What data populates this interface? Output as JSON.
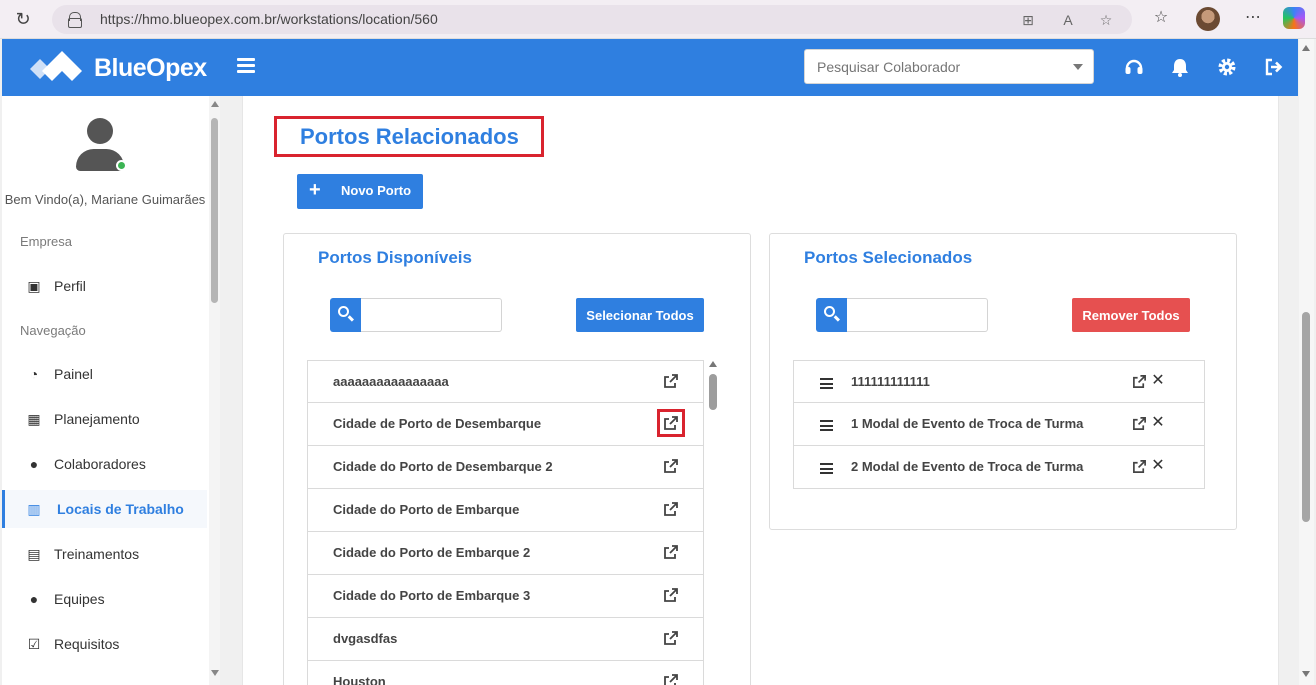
{
  "browser": {
    "url": "https://hmo.blueopex.com.br/workstations/location/560"
  },
  "header": {
    "brand": "BlueOpex",
    "search_placeholder": "Pesquisar Colaborador"
  },
  "sidebar": {
    "welcome": "Bem Vindo(a), Mariane Guimarães",
    "section_empresa": "Empresa",
    "section_navegacao": "Navegação",
    "items": [
      {
        "label": "Perfil",
        "icon": "briefcase-icon"
      },
      {
        "label": "Painel",
        "icon": "dashboard-icon"
      },
      {
        "label": "Planejamento",
        "icon": "calendar-icon"
      },
      {
        "label": "Colaboradores",
        "icon": "users-icon"
      },
      {
        "label": "Locais de Trabalho",
        "icon": "building-icon",
        "active": true
      },
      {
        "label": "Treinamentos",
        "icon": "training-icon"
      },
      {
        "label": "Equipes",
        "icon": "team-icon"
      },
      {
        "label": "Requisitos",
        "icon": "checkbox-icon"
      }
    ]
  },
  "main": {
    "title": "Portos Relacionados",
    "new_button": "Novo Porto",
    "available": {
      "title": "Portos Disponíveis",
      "select_all": "Selecionar Todos",
      "items": [
        "aaaaaaaaaaaaaaaa",
        "Cidade de Porto de Desembarque",
        "Cidade do Porto de Desembarque 2",
        "Cidade do Porto de Embarque",
        "Cidade do Porto de Embarque 2",
        "Cidade do Porto de Embarque 3",
        "dvgasdfas",
        "Houston"
      ]
    },
    "selected": {
      "title": "Portos Selecionados",
      "remove_all": "Remover Todos",
      "items": [
        "111111111111",
        "1 Modal de Evento de Troca de Turma",
        "2 Modal de Evento de Troca de Turma"
      ]
    }
  },
  "colors": {
    "primary": "#2f7fe0",
    "danger": "#e65050",
    "highlight": "#d9232e"
  }
}
